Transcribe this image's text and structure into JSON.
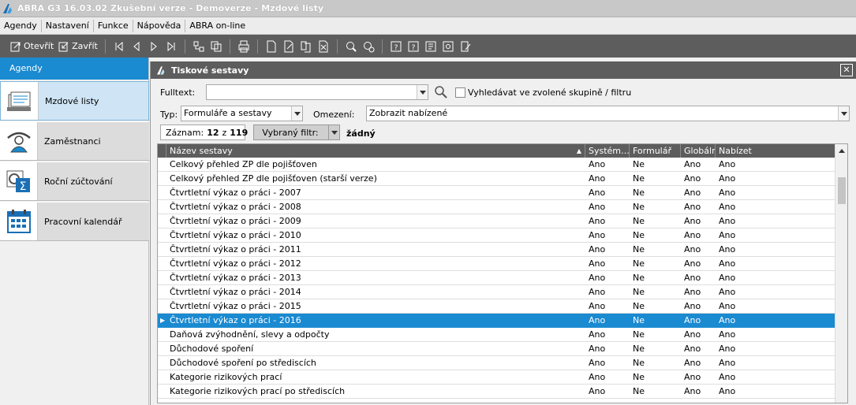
{
  "window": {
    "title": "ABRA G3 16.03.02 Zkušební verze - Demoverze - Mzdové listy"
  },
  "menu": [
    "Agendy",
    "Nastavení",
    "Funkce",
    "Nápověda",
    "ABRA on-line"
  ],
  "toolbar": {
    "open_label": "Otevřít",
    "close_label": "Zavřít"
  },
  "sidebar": {
    "header": "Agendy",
    "items": [
      {
        "label": "Mzdové listy",
        "icon": "payroll-list-icon",
        "active": true
      },
      {
        "label": "Zaměstnanci",
        "icon": "employees-icon",
        "active": false
      },
      {
        "label": "Roční zúčtování",
        "icon": "annual-settlement-icon",
        "active": false
      },
      {
        "label": "Pracovní kalendář",
        "icon": "calendar-icon",
        "active": false
      }
    ]
  },
  "panel": {
    "title": "Tiskové sestavy",
    "fulltext_label": "Fulltext:",
    "fulltext_value": "",
    "search_in_group_label": "Vyhledávat ve zvolené skupině / filtru",
    "type_label": "Typ:",
    "type_value": "Formuláře a sestavy",
    "restriction_label": "Omezení:",
    "restriction_value": "Zobrazit nabízené",
    "record_label": "Záznam:",
    "record_current": "12",
    "record_of": "z",
    "record_total": "119",
    "filter_label": "Vybraný filtr:",
    "filter_value": "žádný"
  },
  "grid": {
    "columns": [
      "Název sestavy",
      "Systém…",
      "Formulář",
      "Globální",
      "Nabízet"
    ],
    "rows": [
      [
        "Celkový přehled ZP dle pojišťoven",
        "Ano",
        "Ne",
        "Ano",
        "Ano"
      ],
      [
        "Celkový přehled ZP dle pojišťoven (starší verze)",
        "Ano",
        "Ne",
        "Ano",
        "Ano"
      ],
      [
        "Čtvrtletní výkaz o práci - 2007",
        "Ano",
        "Ne",
        "Ano",
        "Ano"
      ],
      [
        "Čtvrtletní výkaz o práci - 2008",
        "Ano",
        "Ne",
        "Ano",
        "Ano"
      ],
      [
        "Čtvrtletní výkaz o práci - 2009",
        "Ano",
        "Ne",
        "Ano",
        "Ano"
      ],
      [
        "Čtvrtletní výkaz o práci - 2010",
        "Ano",
        "Ne",
        "Ano",
        "Ano"
      ],
      [
        "Čtvrtletní výkaz o práci - 2011",
        "Ano",
        "Ne",
        "Ano",
        "Ano"
      ],
      [
        "Čtvrtletní výkaz o práci - 2012",
        "Ano",
        "Ne",
        "Ano",
        "Ano"
      ],
      [
        "Čtvrtletní výkaz o práci - 2013",
        "Ano",
        "Ne",
        "Ano",
        "Ano"
      ],
      [
        "Čtvrtletní výkaz o práci - 2014",
        "Ano",
        "Ne",
        "Ano",
        "Ano"
      ],
      [
        "Čtvrtletní výkaz o práci - 2015",
        "Ano",
        "Ne",
        "Ano",
        "Ano"
      ],
      [
        "Čtvrtletní výkaz o práci - 2016",
        "Ano",
        "Ne",
        "Ano",
        "Ano"
      ],
      [
        "Daňová zvýhodnění, slevy a odpočty",
        "Ano",
        "Ne",
        "Ano",
        "Ano"
      ],
      [
        "Důchodové spoření",
        "Ano",
        "Ne",
        "Ano",
        "Ano"
      ],
      [
        "Důchodové spoření po střediscích",
        "Ano",
        "Ne",
        "Ano",
        "Ano"
      ],
      [
        "Kategorie rizikových prací",
        "Ano",
        "Ne",
        "Ano",
        "Ano"
      ],
      [
        "Kategorie rizikových prací po střediscích",
        "Ano",
        "Ne",
        "Ano",
        "Ano"
      ]
    ],
    "selected_index": 11
  },
  "colors": {
    "accent": "#1a8ad1",
    "dark": "#5d5d5d"
  }
}
